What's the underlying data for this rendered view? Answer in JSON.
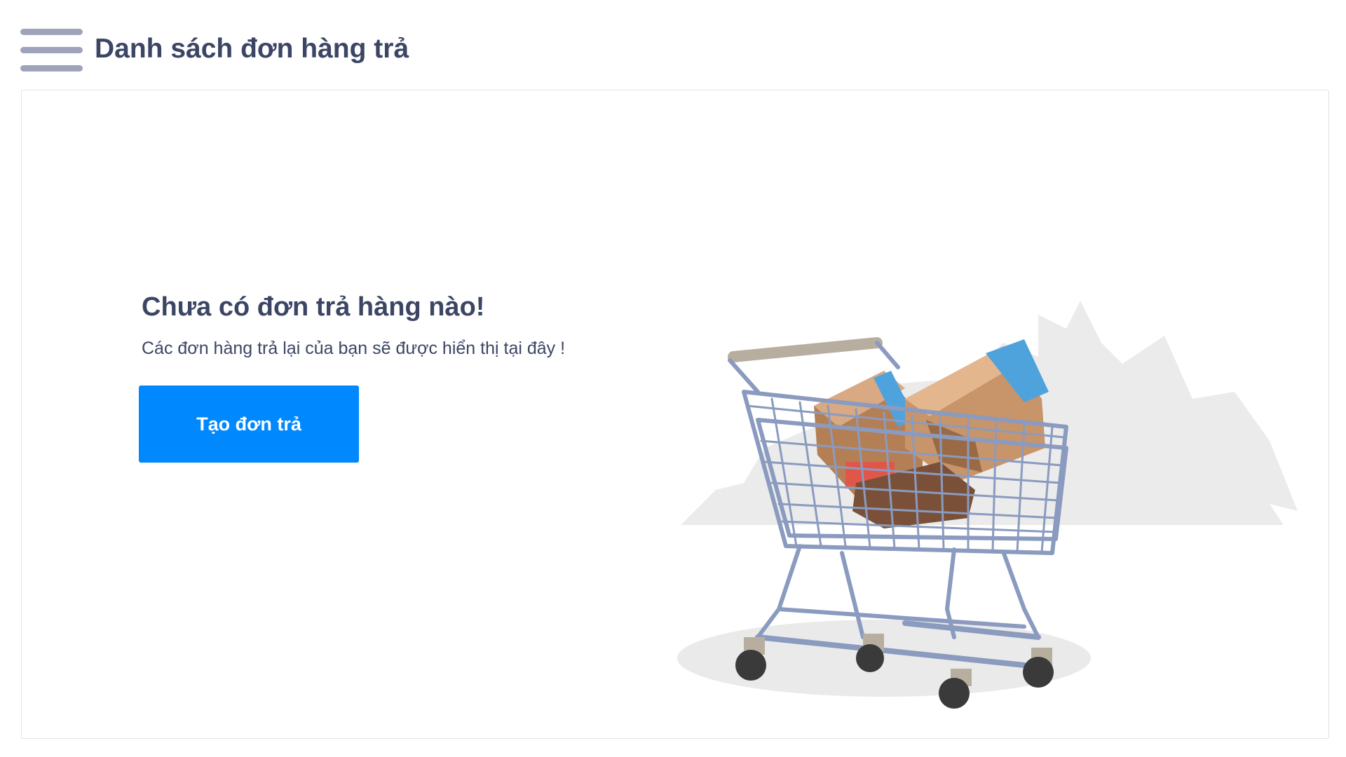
{
  "header": {
    "menu_icon": "hamburger-menu-icon",
    "title": "Danh sách đơn hàng trả"
  },
  "empty_state": {
    "title": "Chưa có đơn trả hàng nào!",
    "description": "Các đơn hàng trả lại của bạn sẽ được hiển thị tại đây !",
    "button_label": "Tạo đơn trả",
    "illustration": "shopping-cart-with-boxes-illustration"
  },
  "colors": {
    "primary_button": "#0088ff",
    "heading_text": "#3c4664",
    "menu_icon": "#9ea3bb",
    "card_border": "#dfe3ea",
    "cart_frame": "#8a9bbf",
    "box_brown": "#c8946a",
    "box_tape": "#4fa3dc"
  }
}
